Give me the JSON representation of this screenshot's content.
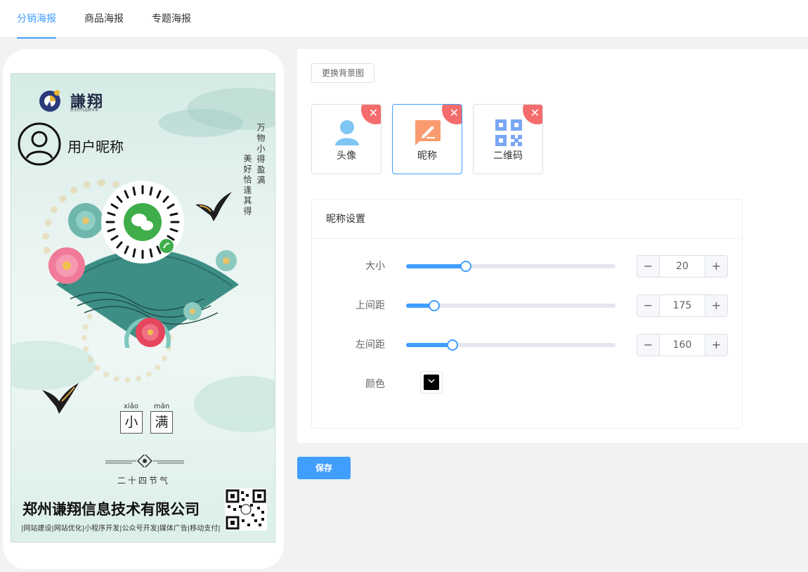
{
  "tabs": [
    {
      "label": "分销海报",
      "active": true
    },
    {
      "label": "商品海报",
      "active": false
    },
    {
      "label": "专题海报",
      "active": false
    }
  ],
  "poster": {
    "brand": "謙翔",
    "brand_sub": "数化时代品牌专家",
    "nickname": "用户昵称",
    "poem_col1": "万物小得盈满",
    "poem_col2": "美好恰逢其得",
    "pinyin": [
      "xiǎo",
      "mǎn"
    ],
    "title_chars": [
      "小",
      "满"
    ],
    "jieqi": "二十四节气",
    "company": "郑州谦翔信息技术有限公司",
    "services": "|网站建设|网站优化|小程序开发|公众号开发|媒体广告|移动支付|"
  },
  "editor": {
    "change_bg_label": "更换背景图",
    "elements": [
      {
        "label": "头像",
        "icon": "avatar-icon",
        "selected": false
      },
      {
        "label": "昵称",
        "icon": "nickname-icon",
        "selected": true
      },
      {
        "label": "二维码",
        "icon": "qrcode-icon",
        "selected": false
      }
    ],
    "settings_title": "昵称设置",
    "rows": [
      {
        "label": "大小",
        "value": "20",
        "fraction": 0.285
      },
      {
        "label": "上间距",
        "value": "175",
        "fraction": 0.135
      },
      {
        "label": "左间距",
        "value": "160",
        "fraction": 0.22
      }
    ],
    "color_label": "颜色",
    "color_value": "#000000",
    "dec_symbol": "−",
    "inc_symbol": "+",
    "close_symbol": "✕",
    "save_label": "保存"
  },
  "colors": {
    "accent": "#409eff",
    "danger": "#f56c6c",
    "nickname_icon": "#fa9b6f",
    "avatar_icon": "#7fc6f5",
    "qrcode_icon": "#7aa7f4"
  }
}
